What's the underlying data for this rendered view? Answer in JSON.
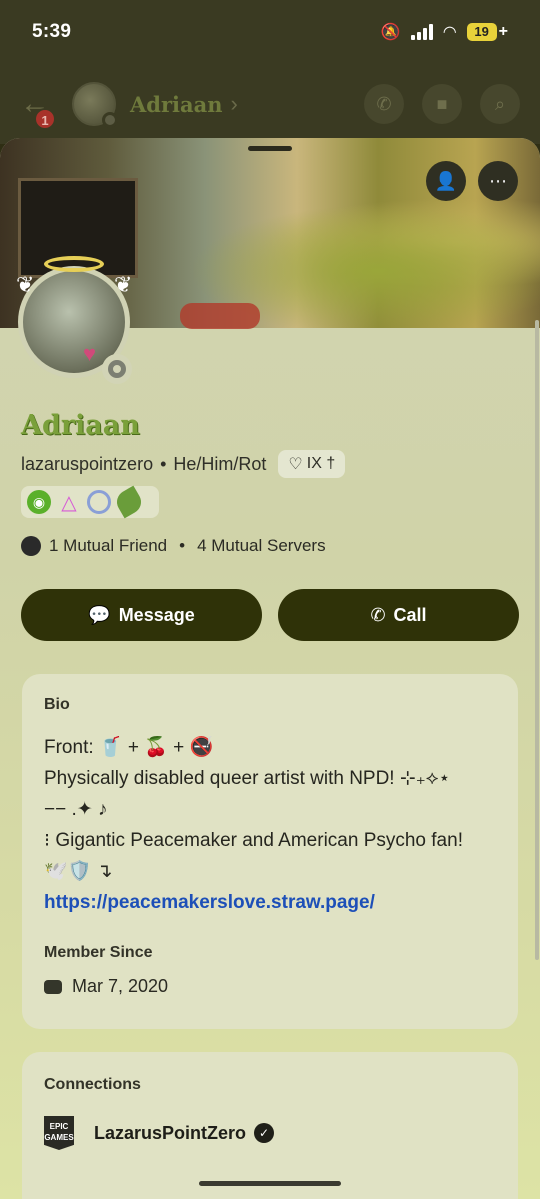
{
  "status_bar": {
    "time": "5:39",
    "battery": "19"
  },
  "header": {
    "back_badge": "1",
    "name": "Adriaan"
  },
  "profile": {
    "display_name": "Adriaan",
    "username": "lazaruspointzero",
    "pronouns": "He/Him/Rot",
    "clan_tag": "IX †",
    "mutual_friends": "1 Mutual Friend",
    "mutual_servers": "4 Mutual Servers"
  },
  "actions": {
    "message": "Message",
    "call": "Call"
  },
  "bio": {
    "label": "Bio",
    "line1": "Front: 🥤 + 🍒 + 🚭",
    "line2": "Physically disabled queer artist with NPD! ⊹₊⟡⋆",
    "line3": "−− .✦ ♪",
    "line4": "⁝ Gigantic Peacemaker and American Psycho fan!",
    "line5": "🕊️🛡️ ↴",
    "link": "https://peacemakerslove.straw.page/"
  },
  "member_since": {
    "label": "Member Since",
    "date": "Mar 7, 2020"
  },
  "connections": {
    "label": "Connections",
    "items": [
      {
        "service": "EPIC GAMES",
        "name": "LazarusPointZero"
      }
    ]
  }
}
